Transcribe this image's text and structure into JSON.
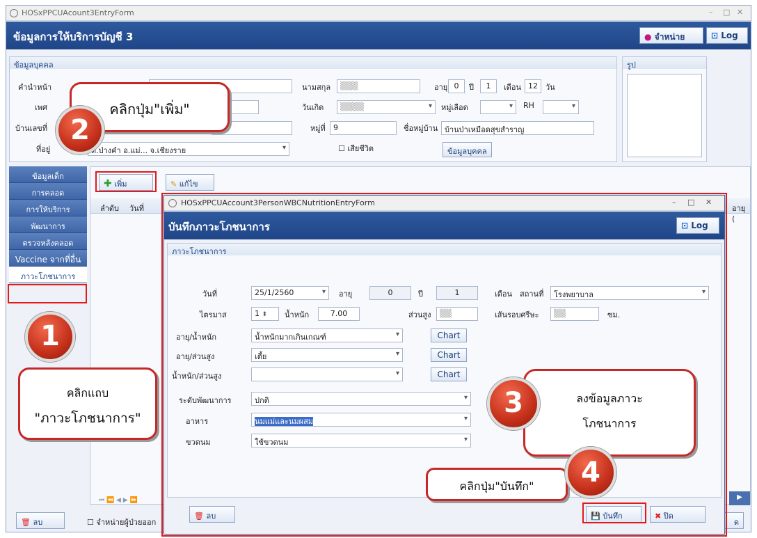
{
  "main": {
    "title": "HOSxPPCUAcount3EntryForm",
    "header": "ข้อมูลการให้บริการบัญชี 3",
    "btn_dispose": "จำหน่าย",
    "btn_log": "Log",
    "person_group": "ข้อมูลบุคคล",
    "photo_group": "รูป",
    "lbl_prefix": "คำนำหน้า",
    "lbl_sex": "เพศ",
    "lbl_house": "บ้านเลขที่",
    "lbl_addr": "ที่อยู่",
    "addr_value": "ต.ป่างคำ อ.แม่... จ.เชียงราย",
    "lbl_lastname": "นามสกุล",
    "lbl_age": "อายุ",
    "age_y": "0",
    "lbl_year": "ปี",
    "age_m": "1",
    "lbl_month": "เดือน",
    "age_d": "12",
    "lbl_day": "วัน",
    "lbl_birth": "วันเกิด",
    "lbl_blood": "หมู่เลือด",
    "lbl_rh": "RH",
    "lbl_moo": "หมู่ที่",
    "moo_value": "9",
    "lbl_village": "ชื่อหมู่บ้าน",
    "village_value": "บ้านป่าเหมือดสุขสำราญ",
    "dead_label": "เสียชีวิต",
    "btn_person": "ข้อมูลบุคคล",
    "side_tabs": [
      "ข้อมูลเด็ก",
      "การคลอด",
      "การให้บริการ",
      "พัฒนาการ",
      "ตรวจหลังคลอด",
      "Vaccine จากที่อื่น",
      "ภาวะโภชนาการ"
    ],
    "btn_add": "เพิ่ม",
    "btn_edit": "แก้ไข",
    "col_order": "ลำดับ",
    "col_date": "วันที่",
    "col_age": "อายุ (",
    "nav": "⏮ ⏪ ◀ ▶ ⏩",
    "btn_delete": "ลบ",
    "chk_discharge": "จำหน่ายผู้ป่วยออก",
    "btn_close_partial": "ด"
  },
  "dialog": {
    "title": "HOSxPPCUAccount3PersonWBCNutritionEntryForm",
    "header": "บันทึกภาวะโภชนาการ",
    "btn_log": "Log",
    "group": "ภาวะโภชนาการ",
    "lbl_date": "วันที่",
    "date": "25/1/2560",
    "lbl_age": "อายุ",
    "age_y": "0",
    "lbl_year": "ปี",
    "age_m": "1",
    "lbl_month": "เดือน",
    "lbl_place": "สถานที่",
    "place": "โรงพยาบาล",
    "lbl_trimester": "ไตรมาส",
    "trimester": "1",
    "lbl_weight": "น้ำหนัก",
    "weight": "7.00",
    "lbl_height": "ส่วนสูง",
    "lbl_head": "เส้นรอบศรีษะ",
    "unit_cm": "ซม.",
    "lbl_age_weight": "อายุ/น้ำหนัก",
    "age_weight": "น้ำหนักมากเกินเกณฑ์",
    "lbl_age_height": "อายุ/ส่วนสูง",
    "age_height": "เตี้ย",
    "lbl_weight_height": "น้ำหนัก/ส่วนสูง",
    "weight_height": "",
    "chart": "Chart",
    "lbl_dev": "ระดับพัฒนาการ",
    "dev": "ปกติ",
    "lbl_food": "อาหาร",
    "food": "นมแม่และนมผสม",
    "lbl_bottle": "ขวดนม",
    "bottle": "ใช้ขวดนม",
    "btn_delete": "ลบ",
    "btn_save": "บันทึก",
    "btn_close": "ปิด"
  },
  "callouts": {
    "c1_line1": "คลิกแถบ",
    "c1_line2": "\"ภาวะโภชนาการ\"",
    "c2": "คลิกปุ่ม\"เพิ่ม\"",
    "c3_line1": "ลงข้อมูลภาวะ",
    "c3_line2": "โภชนาการ",
    "c4": "คลิกปุ่ม\"บันทึก\"",
    "n1": "1",
    "n2": "2",
    "n3": "3",
    "n4": "4"
  },
  "colors": {
    "accent": "#1f4588",
    "highlight": "#e21a1a",
    "callout": "#c5301b"
  }
}
